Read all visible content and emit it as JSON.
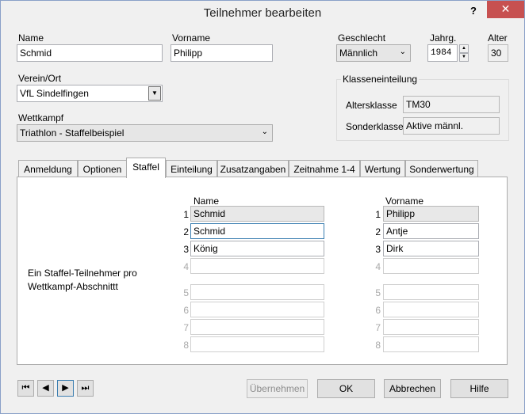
{
  "window": {
    "title": "Teilnehmer bearbeiten",
    "help_label": "?",
    "close_label": "✕"
  },
  "fields": {
    "name_label": "Name",
    "name_value": "Schmid",
    "vorname_label": "Vorname",
    "vorname_value": "Philipp",
    "geschlecht_label": "Geschlecht",
    "geschlecht_value": "Männlich",
    "jahrg_label": "Jahrg.",
    "jahrg_value": "1984",
    "alter_label": "Alter",
    "alter_value": "30",
    "verein_label": "Verein/Ort",
    "verein_value": "VfL Sindelfingen",
    "wettkampf_label": "Wettkampf",
    "wettkampf_value": "Triathlon - Staffelbeispiel"
  },
  "klasseneinteilung": {
    "title": "Klasseneinteilung",
    "altersklasse_label": "Altersklasse",
    "altersklasse_value": "TM30",
    "sonderklasse_label": "Sonderklasse",
    "sonderklasse_value": "Aktive männl."
  },
  "tabs": [
    {
      "label": "Anmeldung"
    },
    {
      "label": "Optionen"
    },
    {
      "label": "Staffel"
    },
    {
      "label": "Einteilung"
    },
    {
      "label": "Zusatzangaben"
    },
    {
      "label": "Zeitnahme 1-4"
    },
    {
      "label": "Wertung"
    },
    {
      "label": "Sonderwertung"
    }
  ],
  "active_tab": "Staffel",
  "staffel": {
    "description_line1": "Ein Staffel-Teilnehmer pro",
    "description_line2": "Wettkampf-Abschnittt",
    "name_header": "Name",
    "vorname_header": "Vorname",
    "rows": [
      {
        "num": "1",
        "name": "Schmid",
        "vorname": "Philipp"
      },
      {
        "num": "2",
        "name": "Schmid",
        "vorname": "Antje"
      },
      {
        "num": "3",
        "name": "König",
        "vorname": "Dirk"
      },
      {
        "num": "4",
        "name": "",
        "vorname": ""
      },
      {
        "num": "5",
        "name": "",
        "vorname": ""
      },
      {
        "num": "6",
        "name": "",
        "vorname": ""
      },
      {
        "num": "7",
        "name": "",
        "vorname": ""
      },
      {
        "num": "8",
        "name": "",
        "vorname": ""
      }
    ]
  },
  "footer": {
    "nav_first": "⏮",
    "nav_prev": "◀",
    "nav_next": "▶",
    "nav_last": "⏭",
    "uebernehmen_label": "Übernehmen",
    "ok_label": "OK",
    "abbrechen_label": "Abbrechen",
    "hilfe_label": "Hilfe"
  },
  "colors": {
    "close_button": "#c75050",
    "focus_border": "#3c7fb1",
    "window_bg": "#f0f0f0"
  }
}
